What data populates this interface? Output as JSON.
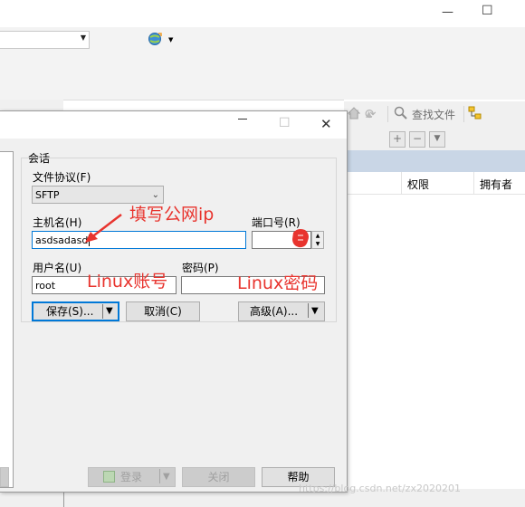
{
  "window": {
    "minimize_glyph": "—",
    "maximize_glyph": "☐"
  },
  "dialog": {
    "maximize_glyph": "☐",
    "close_glyph": "✕",
    "session_group_label": "会话",
    "protocol_label": "文件协议(F)",
    "protocol_value": "SFTP",
    "host_label": "主机名(H)",
    "host_value": "asdsadasd",
    "port_label": "端口号(R)",
    "port_value": "",
    "user_label": "用户名(U)",
    "user_value": "root",
    "password_label": "密码(P)",
    "password_value": "",
    "save_label": "保存(S)...",
    "cancel_label": "取消(C)",
    "advanced_label": "高级(A)...",
    "login_label": "登录",
    "close_label": "关闭",
    "help_label": "帮助"
  },
  "right_pane": {
    "find_files_label": "查找文件",
    "columns": [
      "权限",
      "拥有者"
    ]
  },
  "annotations": {
    "host_hint": "填写公网ip",
    "user_hint": "Linux账号",
    "password_hint": "Linux密码"
  },
  "watermark": "https://blog.csdn.net/zx2020201",
  "colors": {
    "annotation": "#e8342e",
    "focus": "#0078d7",
    "header_band": "#c9d6e6"
  }
}
